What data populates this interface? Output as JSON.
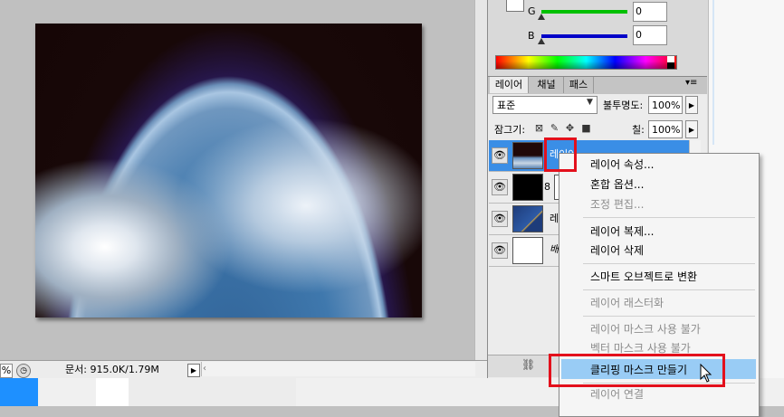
{
  "color_panel": {
    "channels": [
      {
        "label": "G",
        "value": "0",
        "color": "#00b000"
      },
      {
        "label": "B",
        "value": "0",
        "color": "#0000c0"
      }
    ]
  },
  "status_bar": {
    "zoom": "%",
    "doc_size": "문서: 915.0K/1.79M"
  },
  "layers_panel": {
    "tabs": [
      "레이어",
      "채널",
      "패스"
    ],
    "blend_mode": "표준",
    "opacity_label": "불투명도:",
    "opacity_value": "100%",
    "lock_label": "잠그기:",
    "fill_label": "칠:",
    "fill_value": "100%",
    "layers": [
      {
        "name": "레이어",
        "visible": true,
        "selected": true
      },
      {
        "name": "",
        "visible": true,
        "selected": false
      },
      {
        "name": "레",
        "visible": true,
        "selected": false
      },
      {
        "name": "배",
        "visible": true,
        "selected": false
      }
    ]
  },
  "context_menu": {
    "items": [
      {
        "label": "레이어 속성...",
        "enabled": true
      },
      {
        "label": "혼합 옵션...",
        "enabled": true
      },
      {
        "label": "조정 편집...",
        "enabled": false
      },
      {
        "label": "레이어 복제...",
        "enabled": true
      },
      {
        "label": "레이어 삭제",
        "enabled": true
      },
      {
        "label": "스마트 오브젝트로 변환",
        "enabled": true
      },
      {
        "label": "레이어 래스터화",
        "enabled": false
      },
      {
        "label": "레이어 마스크 사용 불가",
        "enabled": false
      },
      {
        "label": "벡터 마스크 사용 불가",
        "enabled": false
      },
      {
        "label": "클리핑 마스크 만들기",
        "enabled": true,
        "highlighted": true
      },
      {
        "label": "레이어 연결",
        "enabled": false
      }
    ]
  },
  "icons": {
    "eye": "eye-icon",
    "link": "link-icon",
    "lock_transparent": "lock-transparent-icon",
    "lock_paint": "brush-icon",
    "lock_move": "move-icon",
    "lock_all": "lock-icon"
  },
  "accent_colors": {
    "selection": "#3a8ee6",
    "menu_highlight": "#99ccf5",
    "callout_red": "#e3101c"
  }
}
